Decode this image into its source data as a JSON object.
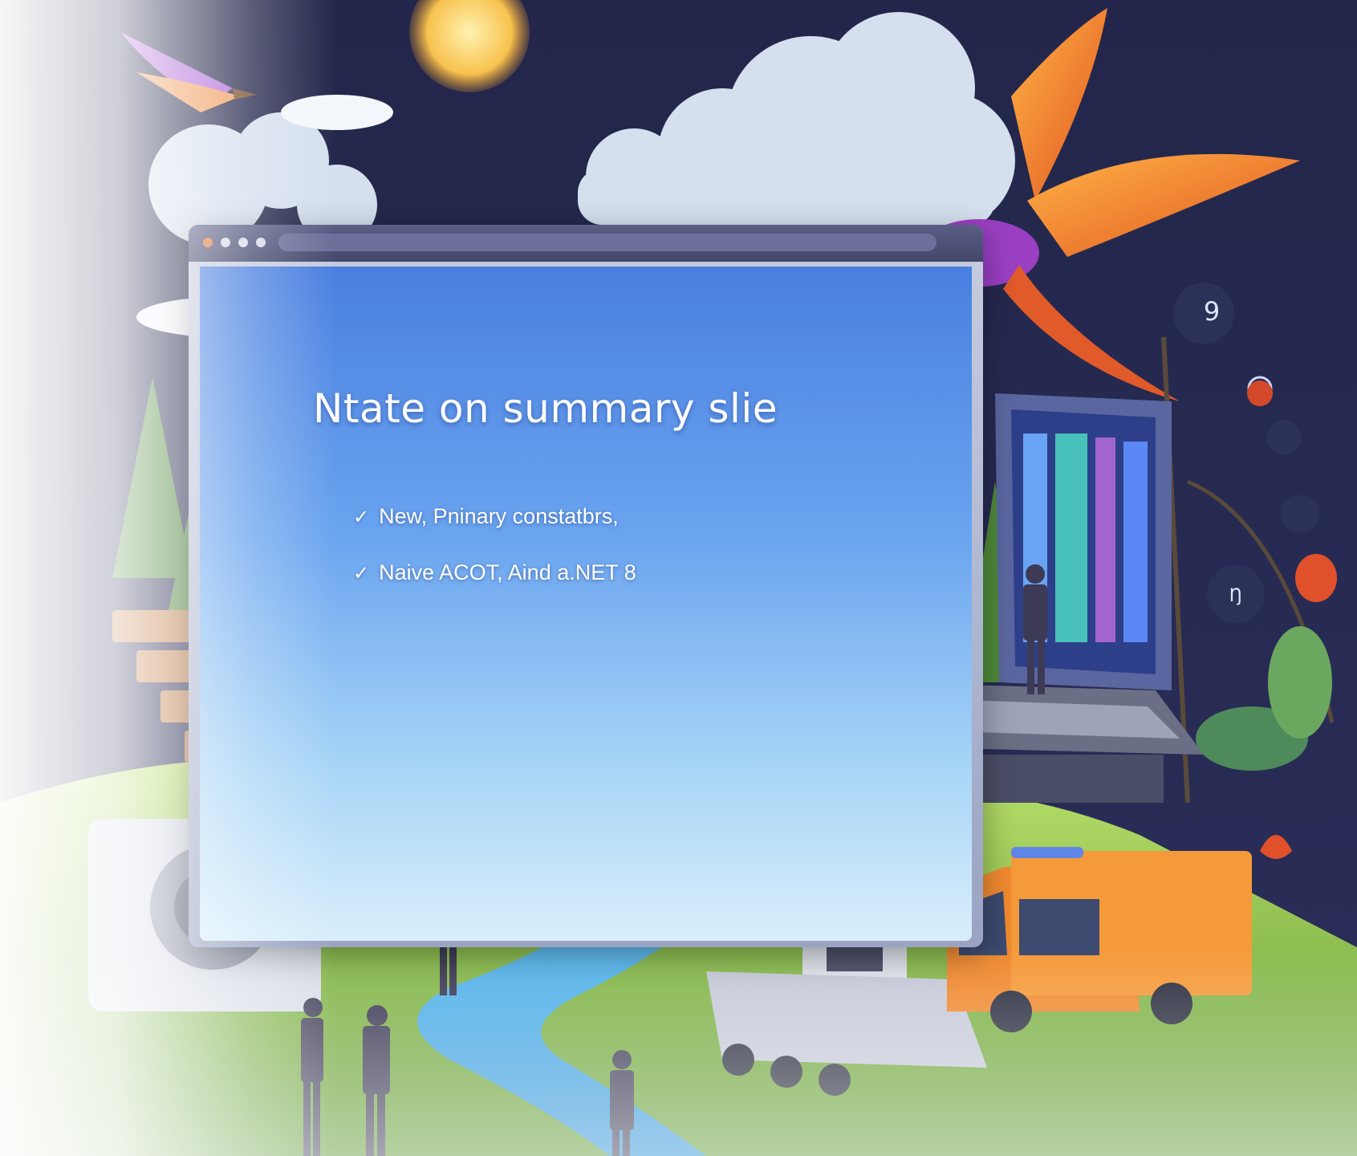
{
  "slide": {
    "title": "Ntate on summary slie",
    "bullets": [
      {
        "check": "✓",
        "text": "New, Pninary constatbrs,"
      },
      {
        "check": "✓",
        "text": "Naive ACOT, Aind a.NET 8"
      }
    ]
  },
  "decor": {
    "badge_top_right": "9",
    "badge_mid_right": "Ŋ",
    "icons": [
      "sun-icon",
      "cloud-icon",
      "bird-icon",
      "tree-icon",
      "river-icon",
      "truck-icon",
      "laptop-icon",
      "person-icon"
    ]
  },
  "colors": {
    "sky_dark": "#1b1f3d",
    "screen_blue": "#4a7fe0",
    "bird_orange": "#f07a2a",
    "bird_purple": "#8a3fc0",
    "grass": "#8fc84a",
    "river": "#3fb8e8",
    "truck": "#f08a30"
  }
}
